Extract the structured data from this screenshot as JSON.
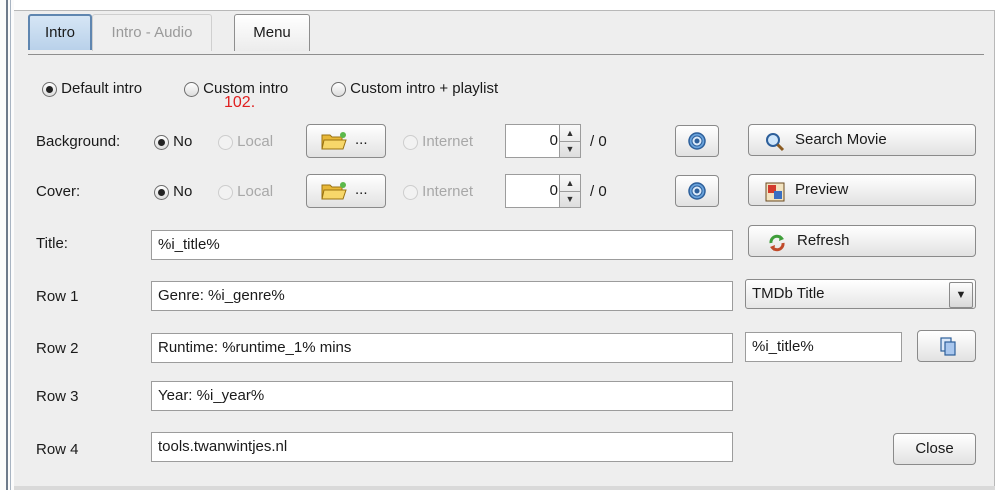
{
  "tabs": [
    {
      "label": "Intro",
      "state": "active"
    },
    {
      "label": "Intro - Audio",
      "state": "disabled"
    },
    {
      "label": "Menu",
      "state": "normal"
    }
  ],
  "intro_mode": {
    "options": [
      "Default intro",
      "Custom intro",
      "Custom intro + playlist"
    ],
    "selected": "Default intro"
  },
  "overlay_marker": "102.",
  "background": {
    "label": "Background:",
    "opt_no": "No",
    "opt_local": "Local",
    "browse_label": "...",
    "opt_internet": "Internet",
    "spinner_value": "0",
    "total": "/ 0"
  },
  "cover": {
    "label": "Cover:",
    "opt_no": "No",
    "opt_local": "Local",
    "browse_label": "...",
    "opt_internet": "Internet",
    "spinner_value": "0",
    "total": "/ 0"
  },
  "buttons": {
    "search_movie": "Search Movie",
    "preview": "Preview",
    "refresh": "Refresh",
    "close": "Close"
  },
  "fields": {
    "title_label": "Title:",
    "title_value": "%i_title%",
    "row1_label": "Row 1",
    "row1_value": "Genre: %i_genre%",
    "row2_label": "Row 2",
    "row2_value": "Runtime: %runtime_1% mins",
    "row3_label": "Row 3",
    "row3_value": "Year: %i_year%",
    "row4_label": "Row 4",
    "row4_value": "tools.twanwintjes.nl"
  },
  "source_select": {
    "selected": "TMDb Title"
  },
  "variable_field": {
    "value": "%i_title%"
  },
  "colors": {
    "accent": "#5f86b0",
    "marker": "#e02020"
  }
}
